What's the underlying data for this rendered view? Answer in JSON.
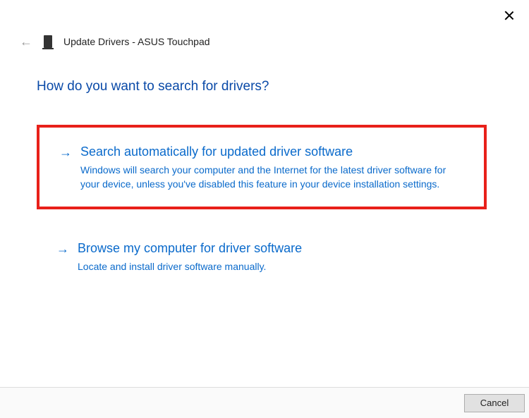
{
  "header": {
    "title": "Update Drivers - ASUS Touchpad"
  },
  "heading": "How do you want to search for drivers?",
  "options": [
    {
      "title": "Search automatically for updated driver software",
      "description": "Windows will search your computer and the Internet for the latest driver software for your device, unless you've disabled this feature in your device installation settings."
    },
    {
      "title": "Browse my computer for driver software",
      "description": "Locate and install driver software manually."
    }
  ],
  "footer": {
    "cancel": "Cancel"
  }
}
